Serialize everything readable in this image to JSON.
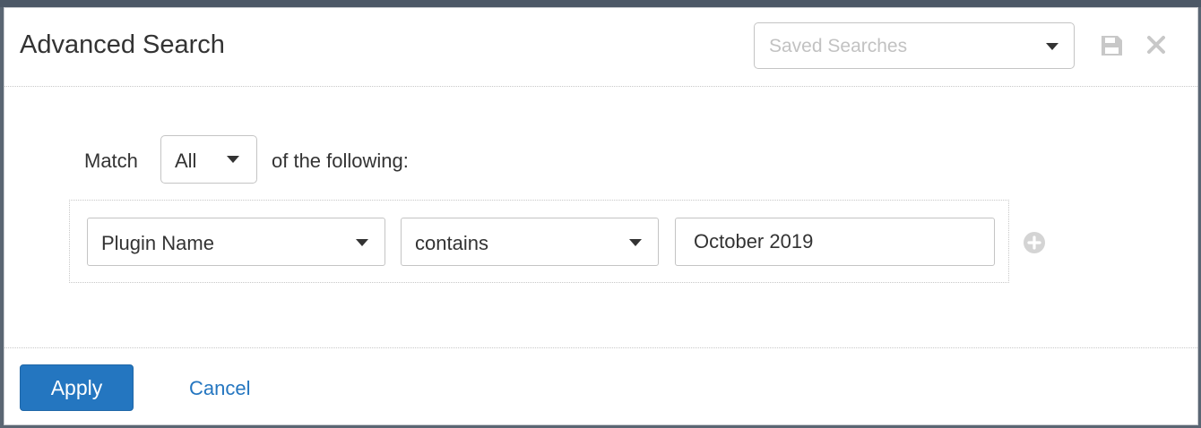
{
  "dialog": {
    "title": "Advanced Search",
    "saved_searches": {
      "placeholder": "Saved Searches"
    },
    "icons": {
      "save": "save-icon",
      "close": "close-icon",
      "add": "plus-circle-icon",
      "dropdown": "caret-down-icon"
    }
  },
  "match": {
    "prefix": "Match",
    "selected": "All",
    "suffix": "of the following:"
  },
  "rules": [
    {
      "field": "Plugin Name",
      "operator": "contains",
      "value": "October 2019"
    }
  ],
  "footer": {
    "apply_label": "Apply",
    "cancel_label": "Cancel"
  },
  "colors": {
    "primary": "#2476c0",
    "text": "#333333",
    "placeholder": "#c2c2c2",
    "icon_gray": "#c8c8c8"
  }
}
